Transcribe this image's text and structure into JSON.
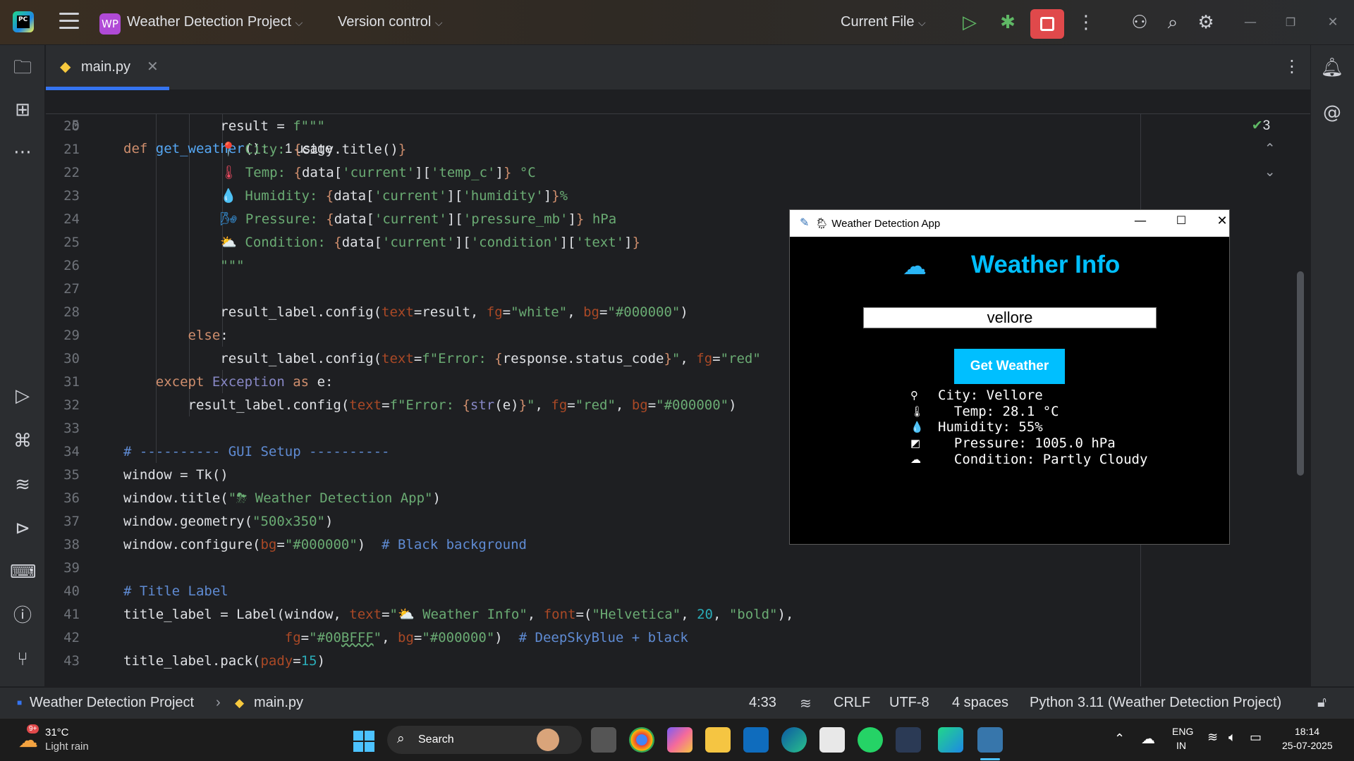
{
  "titlebar": {
    "project_badge": "WP",
    "project_name": "Weather Detection Project",
    "version_control": "Version control",
    "run_config": "Current File"
  },
  "tabs": [
    {
      "label": "main.py",
      "active": true
    }
  ],
  "editor": {
    "inspection_count": "3",
    "sticky_line": {
      "num": "5",
      "usage": "1 usage"
    },
    "lines": [
      {
        "num": "20"
      },
      {
        "num": "21"
      },
      {
        "num": "22"
      },
      {
        "num": "23"
      },
      {
        "num": "24"
      },
      {
        "num": "25"
      },
      {
        "num": "26"
      },
      {
        "num": "27"
      },
      {
        "num": "28"
      },
      {
        "num": "29"
      },
      {
        "num": "30"
      },
      {
        "num": "31"
      },
      {
        "num": "32"
      },
      {
        "num": "33"
      },
      {
        "num": "34"
      },
      {
        "num": "35"
      },
      {
        "num": "36"
      },
      {
        "num": "37"
      },
      {
        "num": "38"
      },
      {
        "num": "39"
      },
      {
        "num": "40"
      },
      {
        "num": "41"
      },
      {
        "num": "42"
      },
      {
        "num": "43"
      }
    ]
  },
  "statusbar": {
    "project": "Weather Detection Project",
    "file": "main.py",
    "position": "4:33",
    "line_endings": "CRLF",
    "encoding": "UTF-8",
    "indent": "4 spaces",
    "interpreter": "Python 3.11 (Weather Detection Project)"
  },
  "app": {
    "title": "🌦 Weather Detection App",
    "heading": "Weather Info",
    "input_value": "vellore",
    "button": "Get Weather",
    "results": [
      {
        "icon": "pin-icon",
        "text": "City: Vellore"
      },
      {
        "icon": "thermometer-icon",
        "text": "  Temp: 28.1 °C"
      },
      {
        "icon": "droplet-icon",
        "text": "Humidity: 55%"
      },
      {
        "icon": "gauge-icon",
        "text": "  Pressure: 1005.0 hPa"
      },
      {
        "icon": "cloud-icon",
        "text": "  Condition: Partly Cloudy"
      }
    ]
  },
  "taskbar": {
    "weather_temp": "31°C",
    "weather_desc": "Light rain",
    "weather_badge": "9+",
    "search_label": "Search",
    "lang": "ENG",
    "region": "IN",
    "time": "18:14",
    "date": "25-07-2025"
  },
  "colors": {
    "accent": "#3574f0",
    "stop_button": "#e0494b",
    "app_accent": "#00BFFF"
  }
}
